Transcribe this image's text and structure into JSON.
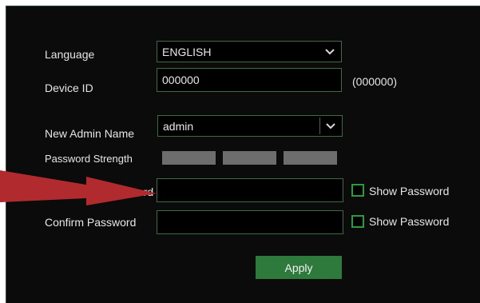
{
  "form": {
    "language": {
      "label": "Language",
      "value": "ENGLISH"
    },
    "device_id": {
      "label": "Device ID",
      "value": "000000",
      "hint": "(000000)"
    },
    "admin_name": {
      "label": "New Admin Name",
      "value": "admin"
    },
    "password_strength": {
      "label": "Password Strength",
      "segments": 3
    },
    "new_password": {
      "label": "New Admin Password",
      "value": "",
      "show_label": "Show Password"
    },
    "confirm_password": {
      "label": "Confirm Password",
      "value": "",
      "show_label": "Show Password"
    },
    "apply_label": "Apply"
  },
  "colors": {
    "accent": "#2e7a3c",
    "border": "#3d6b44",
    "annotation_arrow": "#b02a2e"
  },
  "icons": [
    "chevron-down-icon",
    "arrow-annotation"
  ]
}
